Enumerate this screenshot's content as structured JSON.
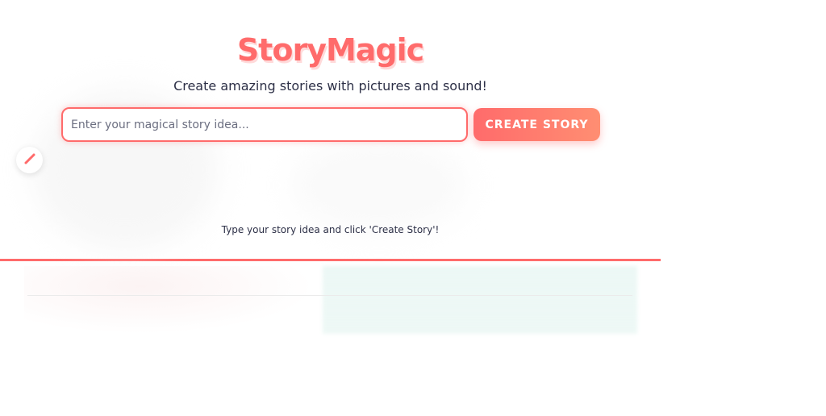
{
  "app": {
    "title": "StoryMagic",
    "subtitle": "Create amazing stories with pictures and sound!"
  },
  "story_form": {
    "input_value": "",
    "input_placeholder": "Enter your magical story idea...",
    "submit_label": "CREATE STORY"
  },
  "edit_button": {
    "icon": "pencil-icon"
  },
  "hint_text": "Type your story idea and click 'Create Story'!",
  "colors": {
    "accent": "#ff6b6b",
    "accent_gradient_end": "#ff8e72",
    "text": "#2d3047"
  }
}
